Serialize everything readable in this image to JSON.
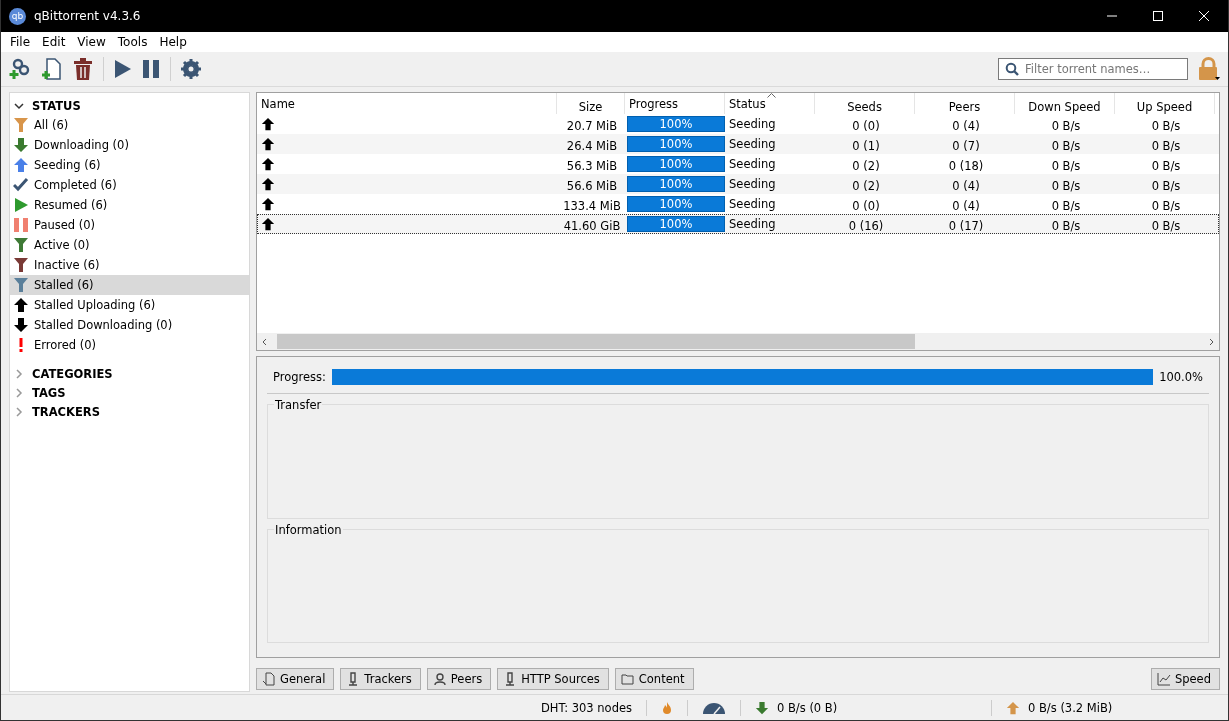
{
  "window": {
    "title": "qBittorrent v4.3.6",
    "logo_text": "qb"
  },
  "menu": [
    "File",
    "Edit",
    "View",
    "Tools",
    "Help"
  ],
  "search": {
    "placeholder": "Filter torrent names…"
  },
  "sidebar": {
    "sections": [
      {
        "title": "STATUS",
        "expanded": true,
        "items": [
          {
            "label": "All (6)",
            "kind": "funnel",
            "color": "#d8954a",
            "selected": false
          },
          {
            "label": "Downloading (0)",
            "kind": "down",
            "color": "#3a7a2f",
            "selected": false
          },
          {
            "label": "Seeding (6)",
            "kind": "up",
            "color": "#4a80e8",
            "selected": false
          },
          {
            "label": "Completed (6)",
            "kind": "check",
            "color": "#3b5573",
            "selected": false
          },
          {
            "label": "Resumed (6)",
            "kind": "play",
            "color": "#2e9a2e",
            "selected": false
          },
          {
            "label": "Paused (0)",
            "kind": "pause",
            "color": "#f08070",
            "selected": false
          },
          {
            "label": "Active (0)",
            "kind": "funnel",
            "color": "#3f7a36",
            "selected": false
          },
          {
            "label": "Inactive (6)",
            "kind": "funnel",
            "color": "#7a3a36",
            "selected": false
          },
          {
            "label": "Stalled (6)",
            "kind": "funnel",
            "color": "#5a7f9a",
            "selected": true
          },
          {
            "label": "Stalled Uploading (6)",
            "kind": "up",
            "color": "#000000",
            "selected": false
          },
          {
            "label": "Stalled Downloading (0)",
            "kind": "down",
            "color": "#000000",
            "selected": false
          },
          {
            "label": "Errored (0)",
            "kind": "error",
            "color": "#ff0000",
            "selected": false
          }
        ]
      },
      {
        "title": "CATEGORIES",
        "expanded": false
      },
      {
        "title": "TAGS",
        "expanded": false
      },
      {
        "title": "TRACKERS",
        "expanded": false
      }
    ]
  },
  "table": {
    "columns": [
      {
        "label": "Name",
        "sorted": false
      },
      {
        "label": "Size",
        "sorted": false
      },
      {
        "label": "Progress",
        "sorted": false
      },
      {
        "label": "Status",
        "sorted": true
      },
      {
        "label": "Seeds",
        "sorted": false
      },
      {
        "label": "Peers",
        "sorted": false
      },
      {
        "label": "Down Speed",
        "sorted": false
      },
      {
        "label": "Up Speed",
        "sorted": false
      }
    ],
    "rows": [
      {
        "size": "20.7 MiB",
        "level": 1,
        "progress": "100%",
        "status": "Seeding",
        "seeds": "0 (0)",
        "peers": "0 (4)",
        "down": "0 B/s",
        "up": "0 B/s",
        "focused": false
      },
      {
        "size": "26.4 MiB",
        "level": 1,
        "progress": "100%",
        "status": "Seeding",
        "seeds": "0 (1)",
        "peers": "0 (7)",
        "down": "0 B/s",
        "up": "0 B/s",
        "focused": false
      },
      {
        "size": "56.3 MiB",
        "level": 1,
        "progress": "100%",
        "status": "Seeding",
        "seeds": "0 (2)",
        "peers": "0 (18)",
        "down": "0 B/s",
        "up": "0 B/s",
        "focused": false
      },
      {
        "size": "56.6 MiB",
        "level": 1,
        "progress": "100%",
        "status": "Seeding",
        "seeds": "0 (2)",
        "peers": "0 (4)",
        "down": "0 B/s",
        "up": "0 B/s",
        "focused": false
      },
      {
        "size": "133.4 MiB",
        "level": 1,
        "progress": "100%",
        "status": "Seeding",
        "seeds": "0 (0)",
        "peers": "0 (4)",
        "down": "0 B/s",
        "up": "0 B/s",
        "focused": false
      },
      {
        "size": "41.60 GiB",
        "level": 1,
        "progress": "100%",
        "status": "Seeding",
        "seeds": "0 (16)",
        "peers": "0 (17)",
        "down": "0 B/s",
        "up": "0 B/s",
        "focused": true
      }
    ]
  },
  "details": {
    "progress_label": "Progress:",
    "level": 1,
    "progress_text": "100.0%",
    "groups": [
      "Transfer",
      "Information"
    ]
  },
  "detail_tabs": [
    {
      "label": "General",
      "kind": "general"
    },
    {
      "label": "Trackers",
      "kind": "tracker"
    },
    {
      "label": "Peers",
      "kind": "peers"
    },
    {
      "label": "HTTP Sources",
      "kind": "tracker"
    },
    {
      "label": "Content",
      "kind": "folder"
    }
  ],
  "speed_button": {
    "label": "Speed"
  },
  "status_bar": {
    "dht": "DHT: 303 nodes",
    "download": "0 B/s (0 B)",
    "upload": "0 B/s (3.2 MiB)"
  }
}
